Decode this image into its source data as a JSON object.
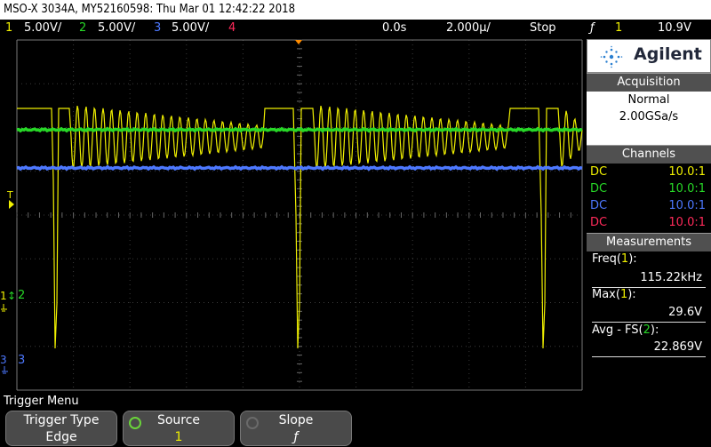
{
  "title_bar": {
    "text": "MSO-X 3034A, MY52160598: Thu Mar 01 12:42:22 2018"
  },
  "status_bar": {
    "ch1": {
      "num": "1",
      "scale": "5.00V/",
      "color": "#f0f000"
    },
    "ch2": {
      "num": "2",
      "scale": "5.00V/",
      "color": "#27d727"
    },
    "ch3": {
      "num": "3",
      "scale": "5.00V/",
      "color": "#4d78ff"
    },
    "ch4": {
      "num": "4",
      "color": "#ff2a5a"
    },
    "time_delay": "0.0s",
    "time_scale": "2.000µ/",
    "run_state": "Stop",
    "trig_symbol": "ƒ",
    "trig_source": "1",
    "trig_level": "10.9V"
  },
  "screen": {
    "trigger_marker": "T",
    "ch2_ground_label": "2",
    "ch3_ground_label": "3"
  },
  "side_panel": {
    "brand": "Agilent",
    "acquisition": {
      "header": "Acquisition",
      "mode": "Normal",
      "rate": "2.00GSa/s"
    },
    "channels": {
      "header": "Channels",
      "rows": [
        {
          "coupling": "DC",
          "probe": "10.0:1",
          "color": "#f0f000"
        },
        {
          "coupling": "DC",
          "probe": "10.0:1",
          "color": "#27d727"
        },
        {
          "coupling": "DC",
          "probe": "10.0:1",
          "color": "#4d78ff"
        },
        {
          "coupling": "DC",
          "probe": "10.0:1",
          "color": "#ff2a5a"
        }
      ]
    },
    "measurements": {
      "header": "Measurements",
      "items": [
        {
          "name": "Freq(",
          "ch": "1",
          "close": "):",
          "value": "115.22kHz",
          "color": "#f0f000"
        },
        {
          "name": "Max(",
          "ch": "1",
          "close": "):",
          "value": "29.6V",
          "color": "#f0f000"
        },
        {
          "name": "Avg - FS(",
          "ch": "2",
          "close": "):",
          "value": "22.869V",
          "color": "#27d727"
        }
      ]
    }
  },
  "menu": {
    "title": "Trigger Menu",
    "softkeys": [
      {
        "label": "Trigger Type",
        "value": "Edge"
      },
      {
        "label": "Source",
        "value": "1"
      },
      {
        "label": "Slope",
        "value": "ƒ"
      }
    ]
  },
  "colors": {
    "ch1": "#f0f000",
    "ch2": "#27d727",
    "ch3": "#4d78ff",
    "ch4": "#ff2a5a",
    "trigger_marker": "#ff8c00"
  }
}
